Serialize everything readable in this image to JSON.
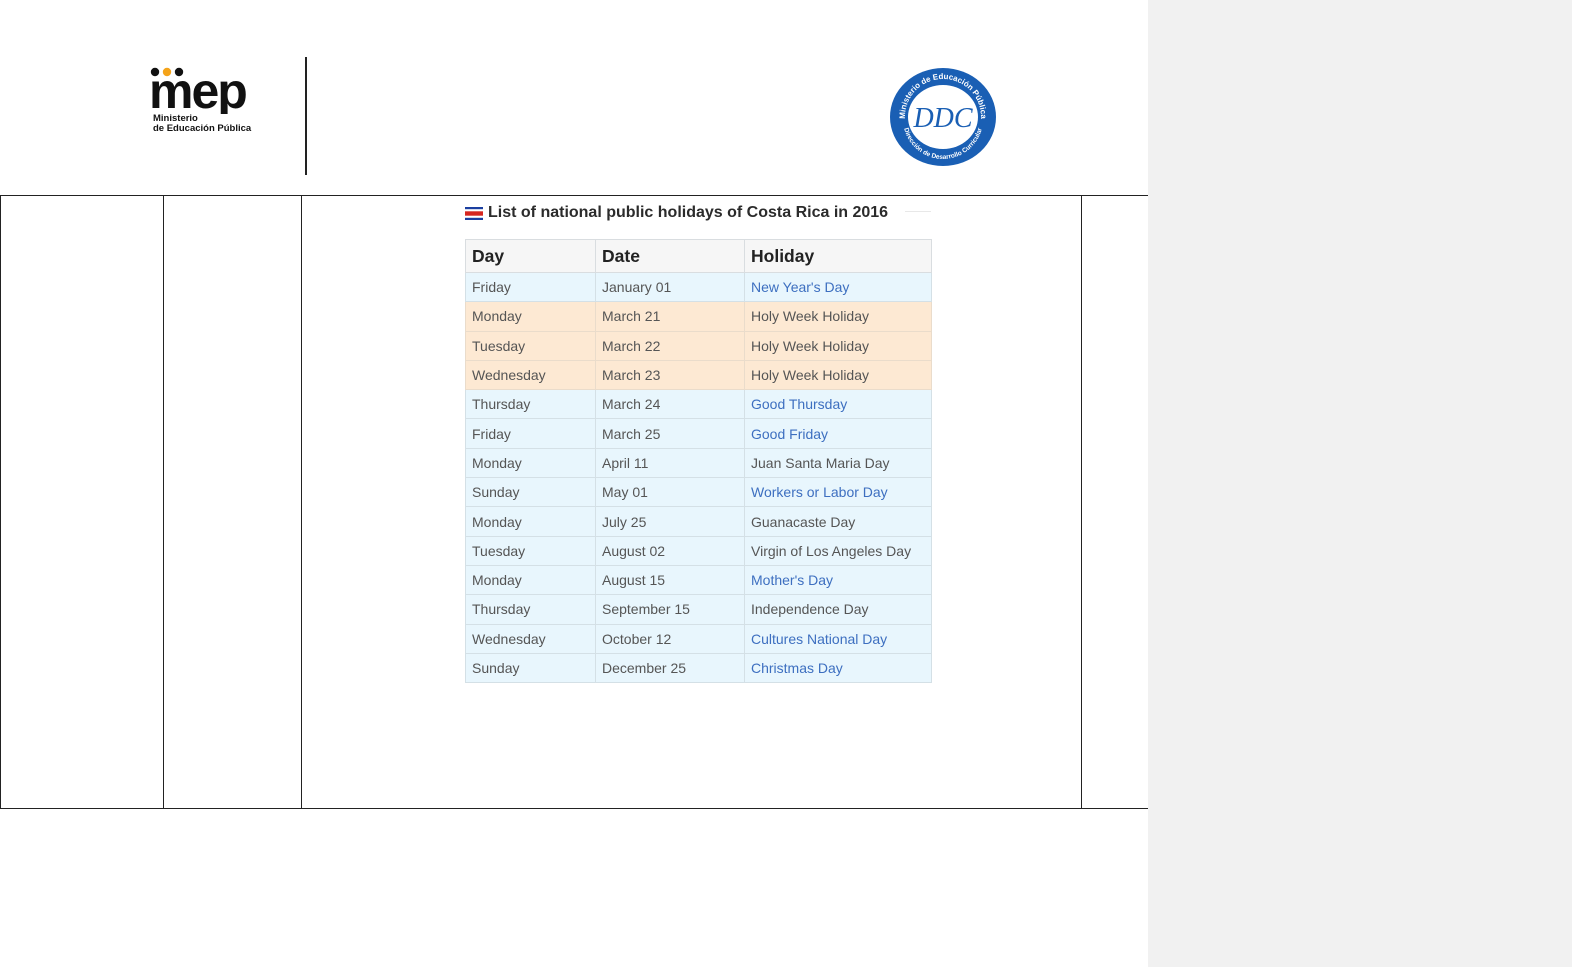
{
  "header": {
    "mep_logo_word": "mep",
    "mep_logo_line1": "Ministerio",
    "mep_logo_line2": "de Educación Pública",
    "seal_ring_top": "Ministerio de Educación Pública",
    "seal_ring_bottom": "Dirección de Desarrollo Curricular",
    "seal_monogram": "DDC"
  },
  "holidays": {
    "caption": "List of national public holidays of Costa Rica in 2016",
    "columns": [
      "Day",
      "Date",
      "Holiday"
    ],
    "rows": [
      {
        "day": "Friday",
        "date": "January 01",
        "holiday": "New Year's Day",
        "style": "blue",
        "link": true
      },
      {
        "day": "Monday",
        "date": "March 21",
        "holiday": "Holy Week Holiday",
        "style": "orange",
        "link": false
      },
      {
        "day": "Tuesday",
        "date": "March 22",
        "holiday": "Holy Week Holiday",
        "style": "orange",
        "link": false
      },
      {
        "day": "Wednesday",
        "date": "March 23",
        "holiday": "Holy Week Holiday",
        "style": "orange",
        "link": false
      },
      {
        "day": "Thursday",
        "date": "March 24",
        "holiday": "Good Thursday",
        "style": "blue",
        "link": true
      },
      {
        "day": "Friday",
        "date": "March 25",
        "holiday": "Good Friday",
        "style": "blue",
        "link": true
      },
      {
        "day": "Monday",
        "date": "April 11",
        "holiday": "Juan Santa Maria Day",
        "style": "blue",
        "link": false
      },
      {
        "day": "Sunday",
        "date": "May 01",
        "holiday": "Workers or Labor Day",
        "style": "blue",
        "link": true
      },
      {
        "day": "Monday",
        "date": "July 25",
        "holiday": "Guanacaste Day",
        "style": "blue",
        "link": false
      },
      {
        "day": "Tuesday",
        "date": "August 02",
        "holiday": "Virgin of Los Angeles Day",
        "style": "blue",
        "link": false
      },
      {
        "day": "Monday",
        "date": "August 15",
        "holiday": "Mother's Day",
        "style": "blue",
        "link": true
      },
      {
        "day": "Thursday",
        "date": "September 15",
        "holiday": "Independence Day",
        "style": "blue",
        "link": false
      },
      {
        "day": "Wednesday",
        "date": "October 12",
        "holiday": "Cultures National Day",
        "style": "blue",
        "link": true
      },
      {
        "day": "Sunday",
        "date": "December 25",
        "holiday": "Christmas Day",
        "style": "blue",
        "link": true
      }
    ]
  },
  "colors": {
    "row_blue": "#e8f6fd",
    "row_orange": "#fde9d3",
    "link": "#3d6fc0",
    "mep_orange": "#f4a31a",
    "seal_blue": "#1a5fb4"
  }
}
